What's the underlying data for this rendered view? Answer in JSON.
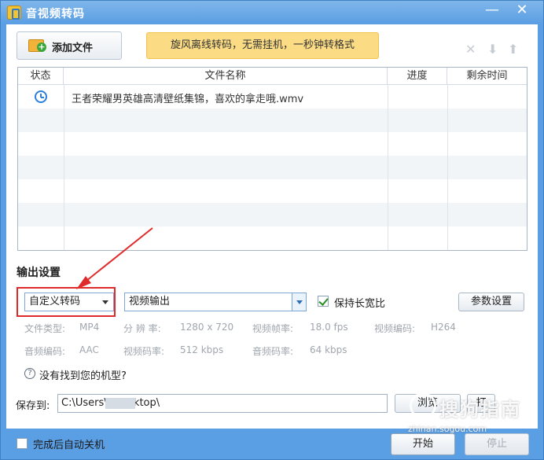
{
  "window": {
    "title": "音视频转码",
    "minimize": "—",
    "close": "✕"
  },
  "toolbar": {
    "add_file_label": "添加文件",
    "banner_text": "旋风离线转码，无需挂机，一秒钟转格式",
    "remove_icon": "✕",
    "down_icon": "⬇",
    "up_icon": "⬆"
  },
  "file_table": {
    "headers": [
      "状态",
      "文件名称",
      "进度",
      "剩余时间"
    ],
    "rows": [
      {
        "status_icon": "clock-icon",
        "name": "王者荣耀男英雄高清壁纸集锦，喜欢的拿走哦.wmv",
        "progress": "",
        "remaining": ""
      }
    ]
  },
  "output": {
    "section_title": "输出设置",
    "preset": "自定义转码",
    "format": "视频输出",
    "keep_ratio_label": "保持长宽比",
    "keep_ratio_checked": true,
    "param_button": "参数设置",
    "info_row1": [
      {
        "label": "文件类型:",
        "value": "MP4"
      },
      {
        "label": "分 辨 率:",
        "value": "1280 x 720"
      },
      {
        "label": "视频帧率:",
        "value": "18.0 fps"
      },
      {
        "label": "视频编码:",
        "value": "H264"
      }
    ],
    "info_row2": [
      {
        "label": "音频编码:",
        "value": "AAC"
      },
      {
        "label": "视频码率:",
        "value": "512 kbps"
      },
      {
        "label": "音频码率:",
        "value": "64 kbps"
      }
    ],
    "help_text": "没有找到您的机型?"
  },
  "save": {
    "label": "保存到:",
    "path": "C:\\Users\\          \\Desktop\\",
    "browse_label": "浏览",
    "open_label": "打"
  },
  "footer": {
    "auto_shutdown_label": "完成后自动关机",
    "start_label": "开始",
    "stop_label": "停止"
  },
  "watermark": {
    "main": "搜狗指南",
    "sub": "zhinan.sogou.com"
  },
  "colors": {
    "accent": "#5a9ee3",
    "highlight": "#e02b2b",
    "banner": "#fbdc84"
  }
}
